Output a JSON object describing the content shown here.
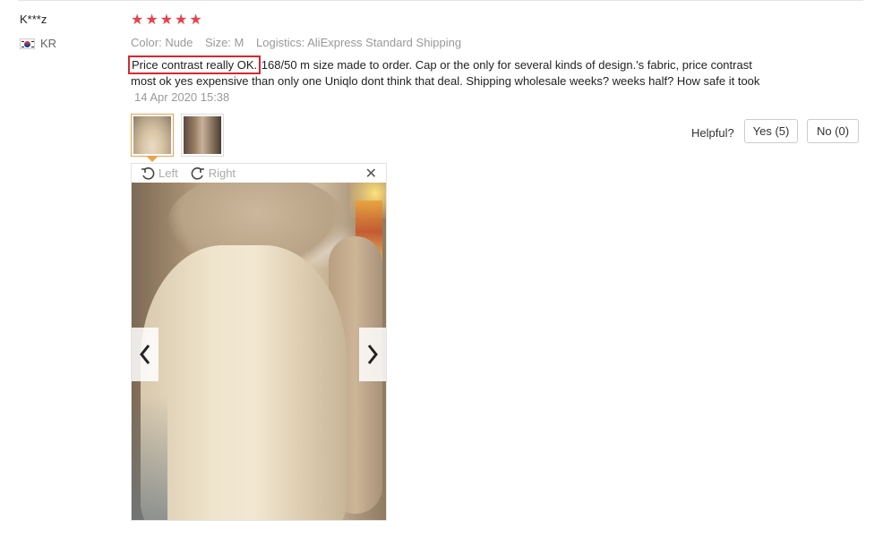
{
  "review": {
    "user_name": "K***z",
    "country_code": "KR",
    "rating_stars": 5,
    "meta": {
      "color_label": "Color:",
      "color_value": "Nude",
      "size_label": "Size:",
      "size_value": "M",
      "logistics_label": "Logistics:",
      "logistics_value": "AliExpress Standard Shipping"
    },
    "text_highlight": "Price contrast really OK.",
    "text_rest": "168/50 m size made to order. Cap or the only for several kinds of design.'s fabric, price contrast most ok yes expensive than only one Uniqlo dont think that deal. Shipping wholesale weeks? weeks half? How safe it took",
    "date": "14 Apr 2020 15:38",
    "helpful_label": "Helpful?",
    "yes_button": "Yes (5)",
    "no_button": "No (0)"
  },
  "viewer": {
    "rotate_left_label": "Left",
    "rotate_right_label": "Right",
    "close_glyph": "✕"
  },
  "colors": {
    "star": "#e6424d",
    "highlight_box": "#d9272e",
    "active_thumb": "#f0a04b"
  }
}
